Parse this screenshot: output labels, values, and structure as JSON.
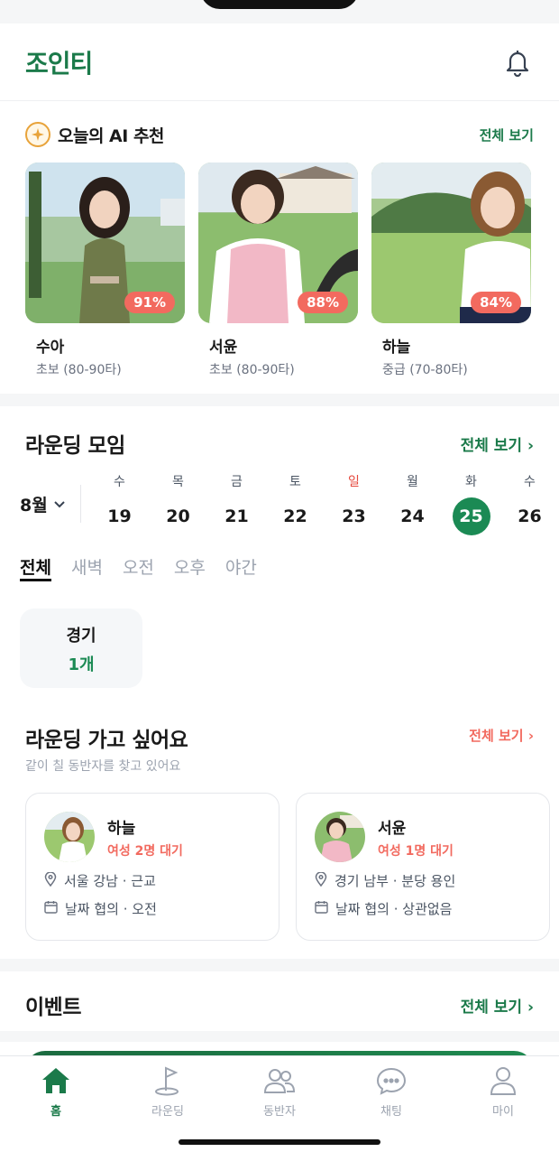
{
  "app": {
    "title": "조인티"
  },
  "ai": {
    "title": "오늘의 AI 추천",
    "view_all": "전체 보기",
    "cards": [
      {
        "name": "수아",
        "level": "초보 (80-90타)",
        "match": "91%"
      },
      {
        "name": "서윤",
        "level": "초보 (80-90타)",
        "match": "88%"
      },
      {
        "name": "하늘",
        "level": "중급 (70-80타)",
        "match": "84%"
      }
    ]
  },
  "rounding": {
    "title": "라운딩 모임",
    "view_all": "전체 보기 ›",
    "month": "8월",
    "days": [
      {
        "dow": "수",
        "date": "19"
      },
      {
        "dow": "목",
        "date": "20"
      },
      {
        "dow": "금",
        "date": "21"
      },
      {
        "dow": "토",
        "date": "22"
      },
      {
        "dow": "일",
        "date": "23"
      },
      {
        "dow": "월",
        "date": "24"
      },
      {
        "dow": "화",
        "date": "25"
      },
      {
        "dow": "수",
        "date": "26"
      }
    ],
    "tabs": [
      "전체",
      "새벽",
      "오전",
      "오후",
      "야간"
    ],
    "count": {
      "label": "경기",
      "value": "1개"
    }
  },
  "want": {
    "title": "라운딩 가고 싶어요",
    "subtitle": "같이 칠 동반자를 찾고 있어요",
    "view_all": "전체 보기 ›",
    "cards": [
      {
        "name": "하늘",
        "wait": "여성 2명 대기",
        "location": "서울 강남 · 근교",
        "schedule": "날짜 협의 · 오전"
      },
      {
        "name": "서윤",
        "wait": "여성 1명 대기",
        "location": "경기 남부 · 분당 용인",
        "schedule": "날짜 협의 · 상관없음"
      }
    ]
  },
  "event": {
    "title": "이벤트",
    "view_all": "전체 보기 ›"
  },
  "nav": {
    "items": [
      {
        "label": "홈",
        "icon": "home-icon"
      },
      {
        "label": "라운딩",
        "icon": "golf-flag-icon"
      },
      {
        "label": "동반자",
        "icon": "people-icon"
      },
      {
        "label": "채팅",
        "icon": "chat-icon"
      },
      {
        "label": "마이",
        "icon": "person-icon"
      }
    ]
  },
  "colors": {
    "brand": "#1b7a4a",
    "accent": "#f26a5f",
    "selected_date": "#1b8a54"
  }
}
